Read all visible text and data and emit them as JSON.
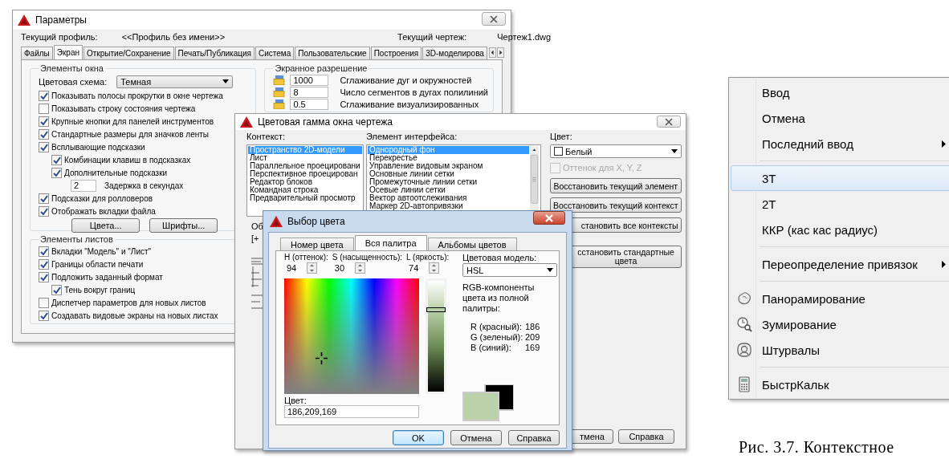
{
  "options_dialog": {
    "title": "Параметры",
    "profile_label": "Текущий профиль:",
    "profile_value": "<<Профиль без имени>>",
    "drawing_label": "Текущий чертеж:",
    "drawing_value": "Чертеж1.dwg",
    "tabs": [
      {
        "label": "Файлы",
        "selected": false
      },
      {
        "label": "Экран",
        "selected": true
      },
      {
        "label": "Открытие/Сохранение",
        "selected": false
      },
      {
        "label": "Печать/Публикация",
        "selected": false
      },
      {
        "label": "Система",
        "selected": false
      },
      {
        "label": "Пользовательские",
        "selected": false
      },
      {
        "label": "Построения",
        "selected": false
      },
      {
        "label": "3D-моделирова",
        "selected": false
      }
    ],
    "window_elements": {
      "title": "Элементы окна",
      "color_scheme_label": "Цветовая схема:",
      "color_scheme_value": "Темная",
      "options": [
        {
          "kind": "checkbox",
          "label": "Показывать полосы прокрутки в окне чертежа",
          "checked": true
        },
        {
          "kind": "checkbox",
          "label": "Показывать строку состояния чертежа",
          "checked": false
        },
        {
          "kind": "checkbox",
          "label": "Крупные кнопки для панелей инструментов",
          "checked": true
        },
        {
          "kind": "checkbox",
          "label": "Стандартные размеры для значков ленты",
          "checked": true
        },
        {
          "kind": "checkbox",
          "label": "Всплывающие подсказки",
          "checked": true,
          "children": [
            {
              "kind": "checkbox",
              "label": "Комбинации клавиш в подсказках",
              "checked": true
            },
            {
              "kind": "checkbox",
              "label": "Дополнительные подсказки",
              "checked": true,
              "children": [
                {
                  "kind": "number",
                  "value": "2",
                  "label": "Задержка в секундах"
                }
              ]
            }
          ]
        },
        {
          "kind": "checkbox",
          "label": "Подсказки для ролловеров",
          "checked": true
        },
        {
          "kind": "checkbox",
          "label": "Отображать вкладки файла",
          "checked": true
        }
      ],
      "buttons": [
        "Цвета...",
        "Шрифты..."
      ]
    },
    "layout_elements": {
      "title": "Элементы листов",
      "options": [
        {
          "kind": "checkbox",
          "label": "Вкладки \"Модель\" и \"Лист\"",
          "checked": true
        },
        {
          "kind": "checkbox",
          "label": "Границы области печати",
          "checked": true
        },
        {
          "kind": "checkbox",
          "label": "Подложить заданный формат",
          "checked": true,
          "children": [
            {
              "kind": "checkbox",
              "label": "Тень вокруг границ",
              "checked": true
            }
          ]
        },
        {
          "kind": "checkbox",
          "label": "Диспетчер параметров для новых листов",
          "checked": false
        },
        {
          "kind": "checkbox",
          "label": "Создавать видовые экраны на новых листах",
          "checked": true
        }
      ]
    },
    "display_resolution": {
      "title": "Экранное разрешение",
      "rows": [
        {
          "value": "1000",
          "label": "Сглаживание дуг и окружностей"
        },
        {
          "value": "8",
          "label": "Число сегментов в дугах полилиний"
        },
        {
          "value": "0.5",
          "label": "Сглаживание визуализированных"
        }
      ]
    }
  },
  "color_scheme_dialog": {
    "title": "Цветовая гамма окна чертежа",
    "context_label": "Контекст:",
    "contexts": [
      {
        "label": "Пространство 2D-модели",
        "selected": true
      },
      {
        "label": "Лист",
        "selected": false
      },
      {
        "label": "Параллельное проецировани",
        "selected": false
      },
      {
        "label": "Перспективное проецирован",
        "selected": false
      },
      {
        "label": "Редактор блоков",
        "selected": false
      },
      {
        "label": "Командная строка",
        "selected": false
      },
      {
        "label": "Предварительный просмотр",
        "selected": false
      }
    ],
    "element_label": "Элемент интерфейса:",
    "elements": [
      {
        "label": "Однородный фон",
        "selected": true
      },
      {
        "label": "Перекрестье",
        "selected": false
      },
      {
        "label": "Управление видовым экраном",
        "selected": false
      },
      {
        "label": "Основные линии сетки",
        "selected": false
      },
      {
        "label": "Промежуточные линии сетки",
        "selected": false
      },
      {
        "label": "Осевые линии сетки",
        "selected": false
      },
      {
        "label": "Вектор автоотслеживания",
        "selected": false
      },
      {
        "label": "Маркер 2D-автопривязки",
        "selected": false
      }
    ],
    "color_label": "Цвет:",
    "color_value": "Белый",
    "tint": {
      "label": "Оттенок для X, Y, Z",
      "checked": false,
      "disabled": true
    },
    "buttons": [
      "Восстановить текущий элемент",
      "Восстановить текущий контекст",
      "становить все контексты",
      "сстановить стандартные цвета"
    ],
    "preview_label": "Об",
    "preview_tag": "[+",
    "bottom_buttons": [
      "тмена",
      "Справка"
    ]
  },
  "color_picker_dialog": {
    "title": "Выбор цвета",
    "tabs": [
      {
        "label": "Номер цвета",
        "selected": false
      },
      {
        "label": "Вся палитра",
        "selected": true
      },
      {
        "label": "Альбомы цветов",
        "selected": false
      }
    ],
    "spinners": [
      {
        "label": "H (оттенок):",
        "value": "94"
      },
      {
        "label": "S (насыщенность):",
        "value": "30"
      },
      {
        "label": "L (яркость):",
        "value": "74"
      }
    ],
    "lightness": {
      "level": 0.74
    },
    "model_label": "Цветовая модель:",
    "model_value": "HSL",
    "rgb_caption": "RGB-компоненты цвета из полной палитры:",
    "rgb": [
      {
        "label": "R (красный):",
        "value": "186"
      },
      {
        "label": "G (зеленый):",
        "value": "209"
      },
      {
        "label": "B (синий):",
        "value": "169"
      }
    ],
    "color_label": "Цвет:",
    "color_value": "186,209,169",
    "buttons": [
      {
        "label": "OK",
        "default": true
      },
      {
        "label": "Отмена",
        "default": false
      },
      {
        "label": "Справка",
        "default": false
      }
    ]
  },
  "context_menu": {
    "items": [
      {
        "kind": "item",
        "label": "Ввод",
        "selected": false
      },
      {
        "kind": "item",
        "label": "Отмена",
        "selected": false
      },
      {
        "kind": "submenu",
        "label": "Последний ввод",
        "selected": false
      },
      {
        "kind": "separator"
      },
      {
        "kind": "item",
        "label": "3Т",
        "selected": true
      },
      {
        "kind": "item",
        "label": "2Т",
        "selected": false
      },
      {
        "kind": "item",
        "label": "ККР (кас кас радиус)",
        "selected": false
      },
      {
        "kind": "separator"
      },
      {
        "kind": "submenu",
        "label": "Переопределение привязок",
        "selected": false
      },
      {
        "kind": "separator"
      },
      {
        "kind": "item",
        "label": "Панорамирование",
        "selected": false
      },
      {
        "kind": "item",
        "label": "Зумирование",
        "selected": false
      },
      {
        "kind": "item",
        "label": "Штурвалы",
        "selected": false
      },
      {
        "kind": "separator"
      },
      {
        "kind": "item",
        "label": "БыстрКальк",
        "selected": false
      }
    ]
  },
  "caption": "Рис. 3.7. Контекстное"
}
